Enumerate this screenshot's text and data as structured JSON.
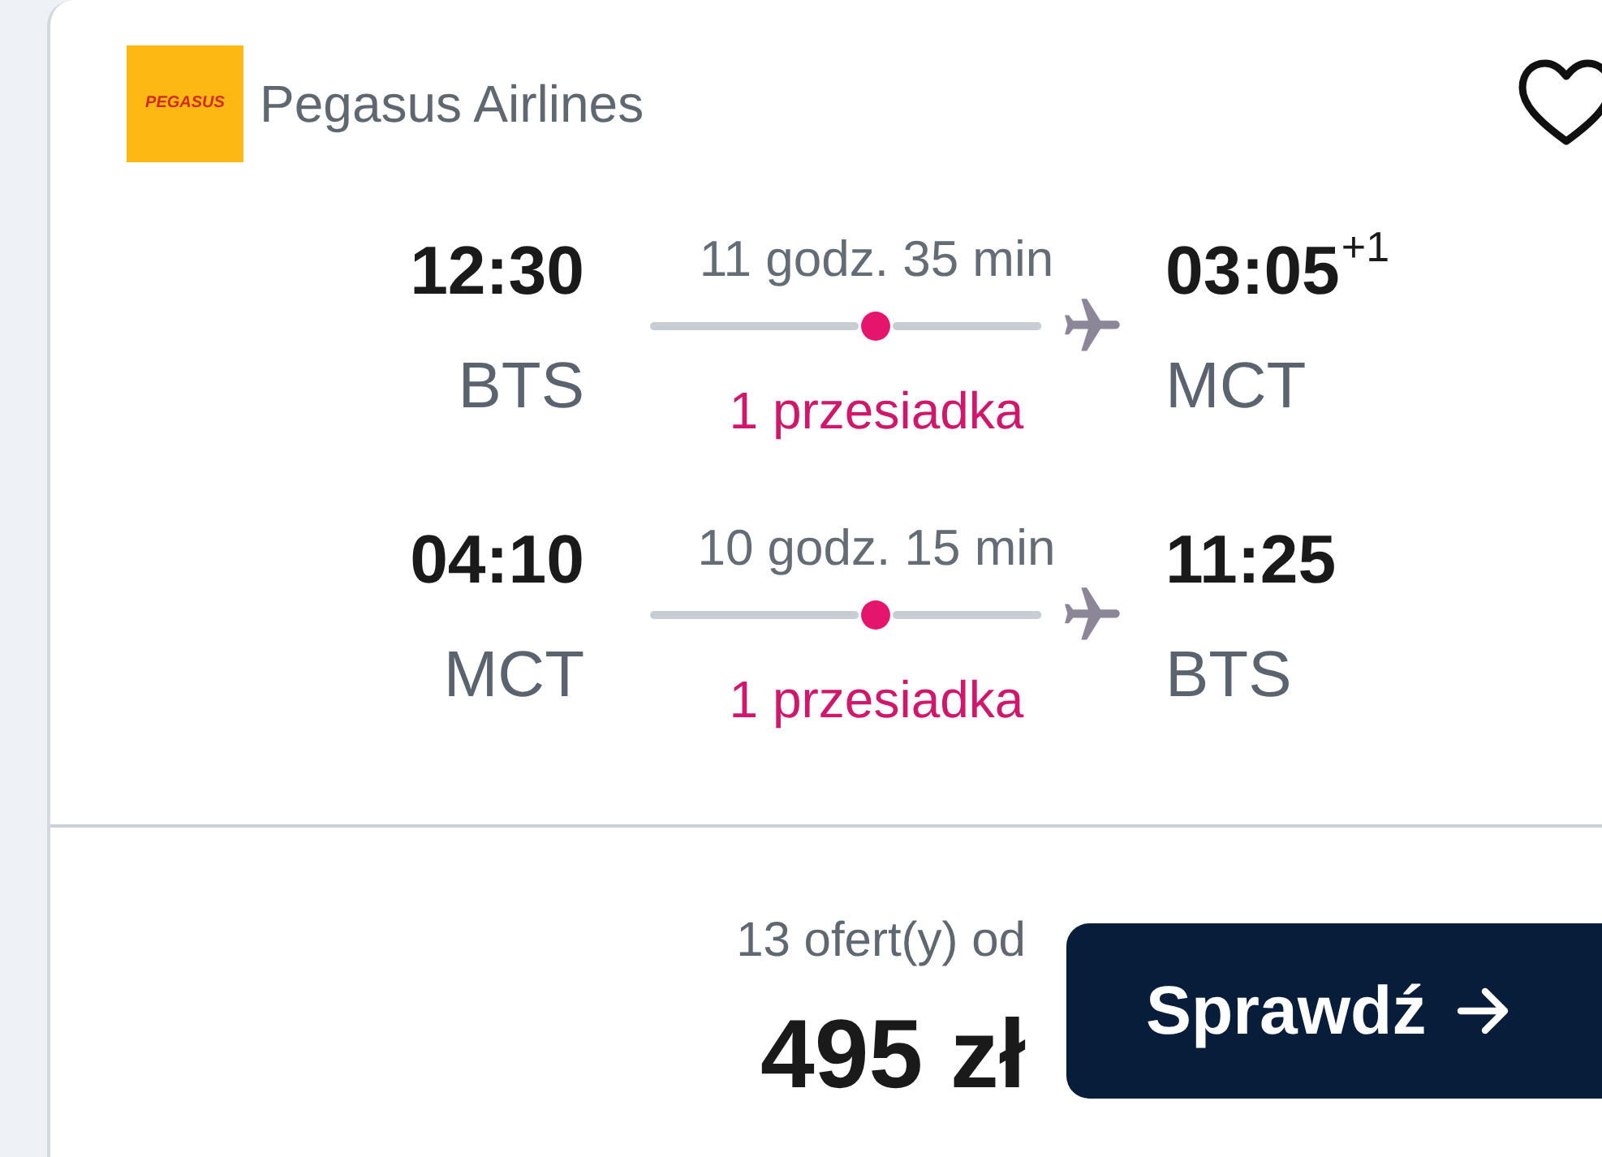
{
  "airline": {
    "logo_text": "PEGASUS",
    "name": "Pegasus Airlines",
    "saved": false
  },
  "flights": [
    {
      "departure_time": "12:30",
      "departure_airport": "BTS",
      "duration": "11 godz. 35 min",
      "direct": false,
      "stops": "1 przesiadka",
      "arrival_time": "03:05",
      "arrival_day_offset": "+1",
      "arrival_airport": "MCT"
    },
    {
      "departure_time": "04:10",
      "departure_airport": "MCT",
      "duration": "10 godz. 15 min",
      "direct": false,
      "stops": "1 przesiadka",
      "arrival_time": "11:25",
      "arrival_airport": "BTS"
    }
  ],
  "price": {
    "offers": "13 ofert(y) od",
    "amount": "495 zł"
  },
  "button": {
    "label": "Sprawdź"
  }
}
